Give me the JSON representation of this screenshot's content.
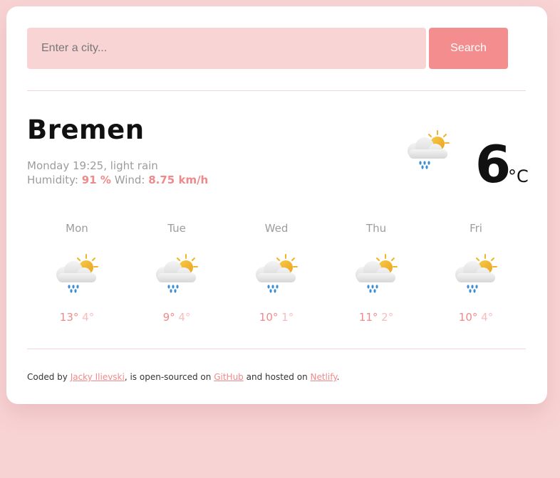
{
  "search": {
    "placeholder": "Enter a city...",
    "value": "",
    "button_label": "Search"
  },
  "current": {
    "city": "Bremen",
    "day_time": "Monday 19:25",
    "description": "light rain",
    "humidity_label": "Humidity:",
    "humidity_value": "91 %",
    "wind_label": "Wind:",
    "wind_value": "8.75 km/h",
    "temperature": "6",
    "unit": "°C",
    "icon": "sun-cloud-rain-icon"
  },
  "forecast": [
    {
      "day": "Mon",
      "max": "13°",
      "min": "4°",
      "icon": "sun-cloud-rain-icon"
    },
    {
      "day": "Tue",
      "max": "9°",
      "min": "4°",
      "icon": "sun-cloud-rain-icon"
    },
    {
      "day": "Wed",
      "max": "10°",
      "min": "1°",
      "icon": "sun-cloud-rain-icon"
    },
    {
      "day": "Thu",
      "max": "11°",
      "min": "2°",
      "icon": "sun-cloud-rain-icon"
    },
    {
      "day": "Fri",
      "max": "10°",
      "min": "4°",
      "icon": "sun-cloud-rain-icon"
    }
  ],
  "footer": {
    "coded_by": "Coded by ",
    "author": "Jacky Ilievski",
    "middle": ", is open-sourced on ",
    "github": "GitHub",
    "hosted": " and hosted on ",
    "netlify": "Netlify",
    "end": "."
  },
  "colors": {
    "background": "#f8d3d4",
    "accent": "#f48e8e",
    "input_background": "#f9d4d5",
    "highlight": "#ef8a8b",
    "min_temp": "#f7bdbd"
  }
}
